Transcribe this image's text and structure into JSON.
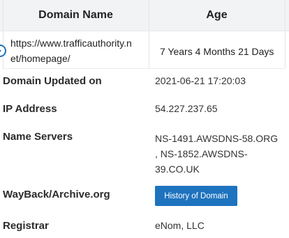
{
  "table": {
    "headers": {
      "domain_name": "Domain Name",
      "age": "Age"
    },
    "row": {
      "url_line1": "https://www.trafficauthority.n",
      "url_line2": "et/homepage/",
      "age": "7 Years 4 Months 21 Days"
    }
  },
  "details": {
    "updated": {
      "label": "Domain Updated on",
      "value": "2021-06-21 17:20:03"
    },
    "ip": {
      "label": "IP Address",
      "value": "54.227.237.65"
    },
    "ns": {
      "label": "Name Servers",
      "value_line1": "NS-1491.AWSDNS-58.ORG",
      "value_line2": ", NS-1852.AWSDNS-",
      "value_line3": "39.CO.UK"
    },
    "wayback": {
      "label": "WayBack/Archive.org",
      "button": "History of Domain"
    },
    "registrar": {
      "label": "Registrar",
      "value": "eNom, LLC"
    }
  },
  "colors": {
    "button_bg": "#1e73be",
    "header_bg": "#f2f3f5"
  },
  "icons": {
    "row_toggle": "expand-circle-icon"
  }
}
